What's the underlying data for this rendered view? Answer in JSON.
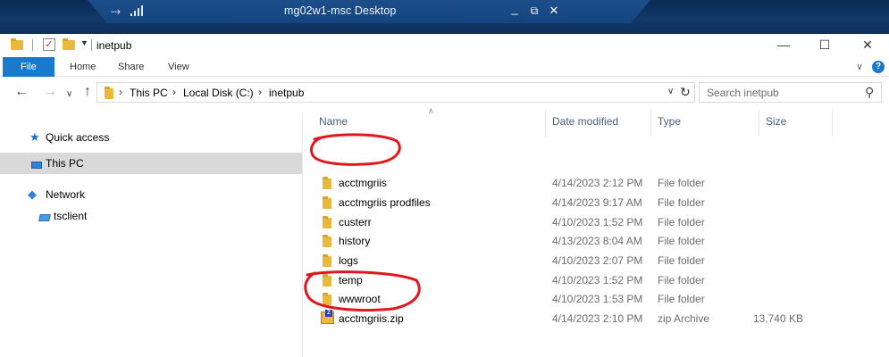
{
  "remote_bar": {
    "title": "mg02w1-msc Desktop",
    "minimize": "_",
    "restore": "⧉",
    "close": "✕"
  },
  "window": {
    "title": "inetpub",
    "controls": {
      "minimize": "—",
      "maximize": "☐",
      "close": "✕"
    }
  },
  "ribbon": {
    "tabs": [
      "File",
      "Home",
      "Share",
      "View"
    ]
  },
  "address": {
    "crumbs": [
      "This PC",
      "Local Disk (C:)",
      "inetpub"
    ],
    "search_placeholder": "Search inetpub"
  },
  "nav": {
    "items": [
      {
        "label": "Quick access",
        "icon": "star-icon",
        "selected": false
      },
      {
        "label": "This PC",
        "icon": "computer-icon",
        "selected": true
      },
      {
        "label": "Network",
        "icon": "network-icon",
        "selected": false
      },
      {
        "label": "tsclient",
        "icon": "network-drive-icon",
        "selected": false
      }
    ]
  },
  "columns": {
    "name": "Name",
    "date": "Date modified",
    "type": "Type",
    "size": "Size"
  },
  "files": [
    {
      "name": "acctmgriis",
      "date": "4/14/2023 2:12 PM",
      "type": "File folder",
      "size": "",
      "icon": "folder-icon"
    },
    {
      "name": "acctmgriis prodfiles",
      "date": "4/14/2023 9:17 AM",
      "type": "File folder",
      "size": "",
      "icon": "folder-icon"
    },
    {
      "name": "custerr",
      "date": "4/10/2023 1:52 PM",
      "type": "File folder",
      "size": "",
      "icon": "folder-icon"
    },
    {
      "name": "history",
      "date": "4/13/2023 8:04 AM",
      "type": "File folder",
      "size": "",
      "icon": "folder-icon"
    },
    {
      "name": "logs",
      "date": "4/10/2023 2:07 PM",
      "type": "File folder",
      "size": "",
      "icon": "folder-icon"
    },
    {
      "name": "temp",
      "date": "4/10/2023 1:52 PM",
      "type": "File folder",
      "size": "",
      "icon": "folder-icon"
    },
    {
      "name": "wwwroot",
      "date": "4/10/2023 1:53 PM",
      "type": "File folder",
      "size": "",
      "icon": "folder-icon"
    },
    {
      "name": "acctmgriis.zip",
      "date": "4/14/2023 2:10 PM",
      "type": "zip Archive",
      "size": "13,740 KB",
      "icon": "zip-archive-icon"
    }
  ],
  "colors": {
    "accent": "#1979ca",
    "annotation": "#e0171d",
    "folder": "#e8b93c",
    "remote_bar": "#13457f"
  }
}
